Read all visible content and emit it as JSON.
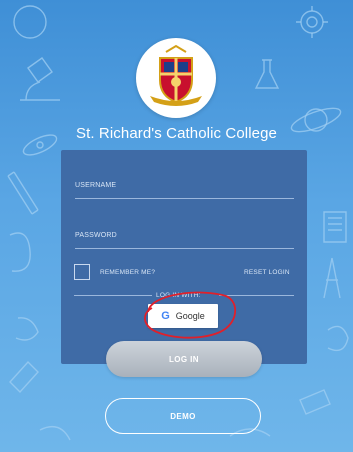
{
  "school": {
    "name": "St. Richard's Catholic College"
  },
  "form": {
    "username_label": "USERNAME",
    "password_label": "PASSWORD",
    "remember_label": "REMEMBER ME?",
    "reset_label": "RESET LOGIN",
    "login_with_label": "LOG IN WITH:",
    "google_label": "Google",
    "google_icon": "G"
  },
  "buttons": {
    "login_label": "LOG IN",
    "demo_label": "DEMO"
  },
  "colors": {
    "background": "#4e9ddf",
    "card": "#3f6ba6",
    "annotation": "#e0202a"
  }
}
